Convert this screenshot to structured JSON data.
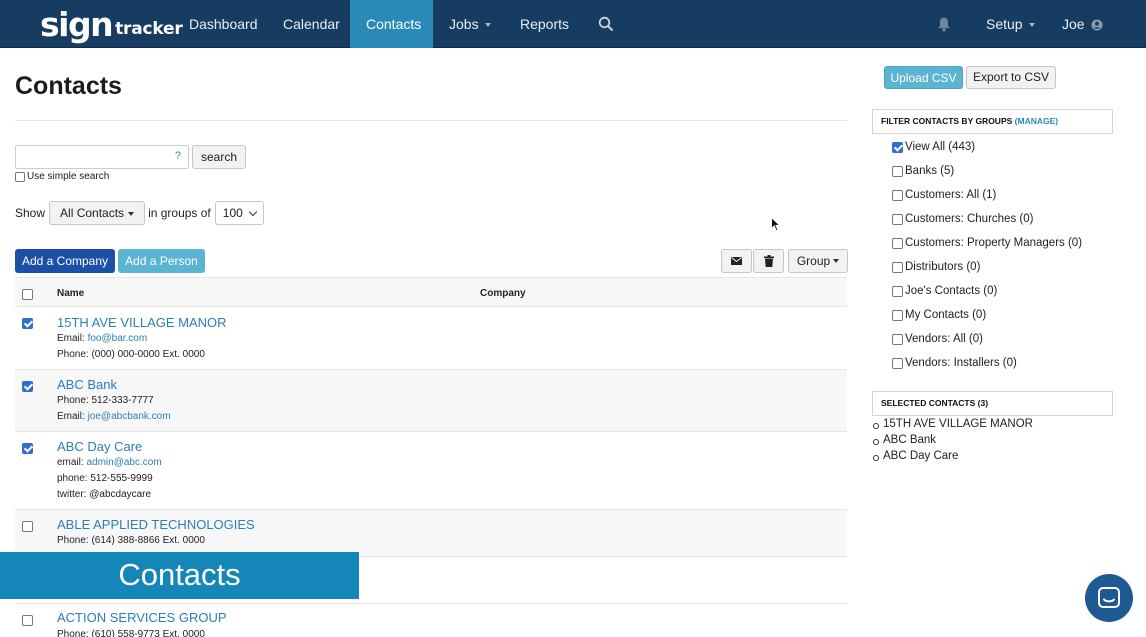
{
  "brand": {
    "logo_main": "sign",
    "logo_sub": "tracker"
  },
  "nav": {
    "dashboard": "Dashboard",
    "calendar": "Calendar",
    "contacts": "Contacts",
    "jobs": "Jobs",
    "reports": "Reports",
    "setup": "Setup",
    "user": "Joe"
  },
  "page": {
    "title": "Contacts"
  },
  "search": {
    "value": "",
    "help": "?",
    "button": "search",
    "simple_label": "Use simple search"
  },
  "show": {
    "label": "Show",
    "filter": "All Contacts",
    "groups_label": "in groups of",
    "page_size": "100"
  },
  "actions": {
    "add_company": "Add a Company",
    "add_person": "Add a Person",
    "group": "Group"
  },
  "table": {
    "col_name": "Name",
    "col_company": "Company",
    "rows": [
      {
        "name": "15TH AVE VILLAGE MANOR",
        "checked": true,
        "l1_label": "Email:",
        "l1_link": "foo@bar.com",
        "l2": "Phone: (000) 000-0000 Ext. 0000"
      },
      {
        "name": "ABC Bank",
        "checked": true,
        "l1": "Phone: 512-333-7777",
        "l2_label": "Email:",
        "l2_link": "joe@abcbank.com"
      },
      {
        "name": "ABC Day Care",
        "checked": true,
        "l1_label": "email:",
        "l1_link": "admin@abc.com",
        "l2": "phone: 512-555-9999",
        "l3": "twitter: @abcdaycare"
      },
      {
        "name": "ABLE APPLIED TECHNOLOGIES",
        "checked": false,
        "l1": "Phone: (614) 388-8866 Ext. 0000"
      },
      {
        "name": "ACTION SERVICES GROUP",
        "checked": false,
        "l1": "Phone: (610) 558-9773 Ext. 0000"
      }
    ]
  },
  "banner": {
    "text": "Contacts"
  },
  "right": {
    "upload": "Upload CSV",
    "export": "Export to CSV",
    "filter_head": "FILTER CONTACTS BY GROUPS",
    "manage": "(MANAGE)",
    "groups": [
      {
        "label": "View All (443)",
        "checked": true
      },
      {
        "label": "Banks (5)",
        "checked": false
      },
      {
        "label": "Customers: All (1)",
        "checked": false
      },
      {
        "label": "Customers: Churches (0)",
        "checked": false
      },
      {
        "label": "Customers: Property Managers (0)",
        "checked": false
      },
      {
        "label": "Distributors (0)",
        "checked": false
      },
      {
        "label": "Joe's Contacts (0)",
        "checked": false
      },
      {
        "label": "My Contacts (0)",
        "checked": false
      },
      {
        "label": "Vendors: All (0)",
        "checked": false
      },
      {
        "label": "Vendors: Installers (0)",
        "checked": false
      }
    ],
    "selected_head": "SELECTED CONTACTS (3)",
    "selected": [
      "15TH AVE VILLAGE MANOR",
      "ABC Bank",
      "ABC Day Care"
    ]
  },
  "colors": {
    "nav_bg": "#173c62",
    "nav_active": "#2a8ab7",
    "link": "#2a7fb4",
    "primary": "#1b4fa8",
    "info": "#5bb5d2"
  }
}
